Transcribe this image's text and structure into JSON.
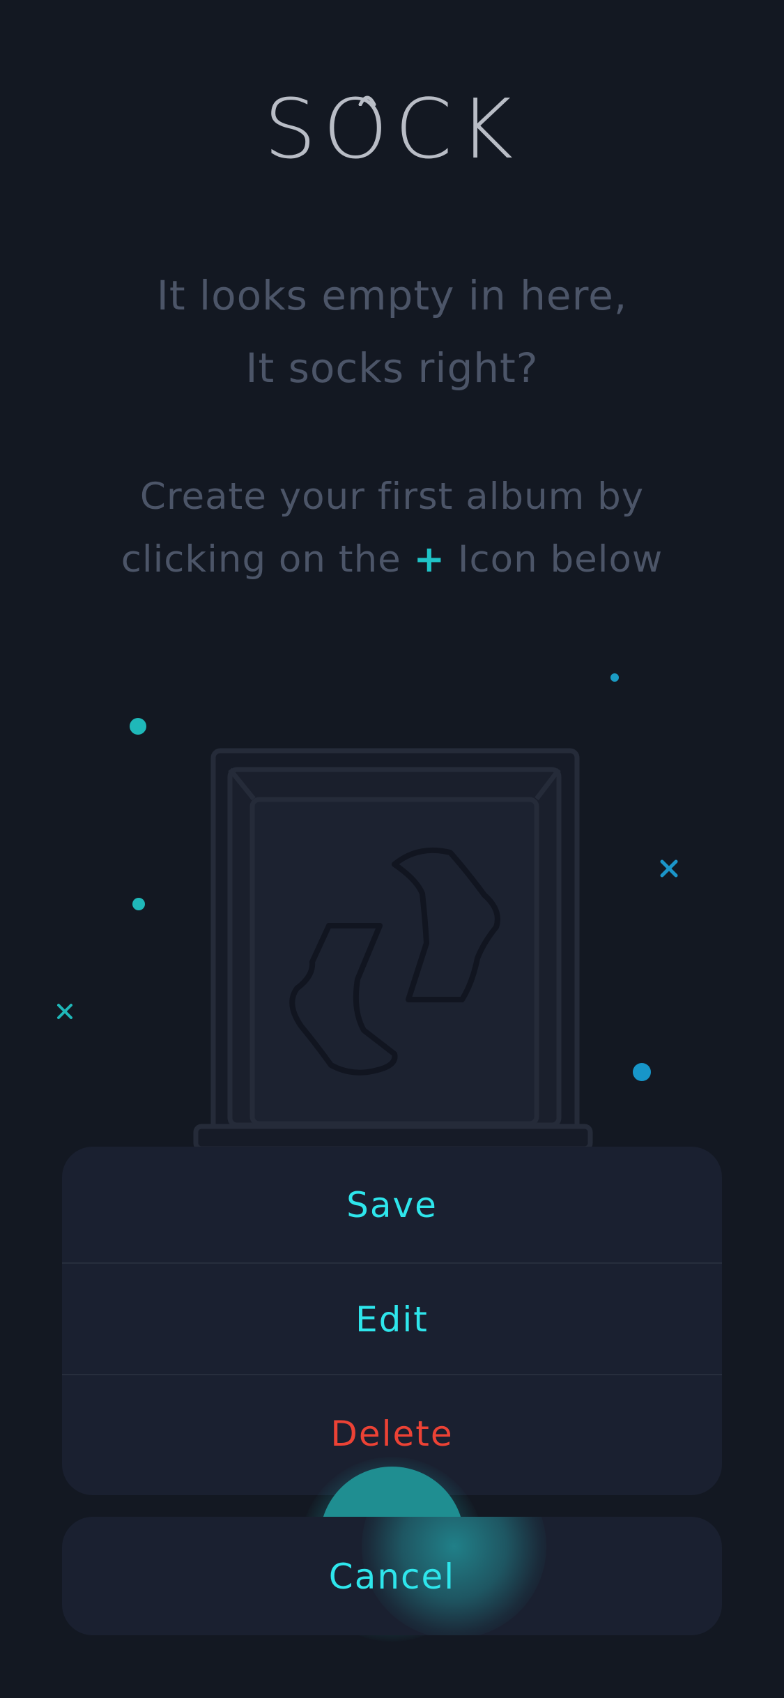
{
  "app": {
    "logo_text": "SOCK"
  },
  "empty_state": {
    "headline_line1": "It looks empty in here,",
    "headline_line2": "It socks right?",
    "instruction_line1": "Create your first album by",
    "instruction_line2_before": "clicking on the ",
    "instruction_plus": "+",
    "instruction_line2_after": " Icon below"
  },
  "action_sheet": {
    "save_label": "Save",
    "edit_label": "Edit",
    "delete_label": "Delete",
    "cancel_label": "Cancel"
  },
  "icons": {
    "album_frame": "photo-frame-with-socks-icon",
    "add": "plus-icon"
  },
  "colors": {
    "background": "#131822",
    "accent": "#2ee6ec",
    "accent_dark": "#1f8e91",
    "danger": "#ec4235",
    "muted_text": "#4c5568",
    "sheet_bg": "#1a2030"
  }
}
